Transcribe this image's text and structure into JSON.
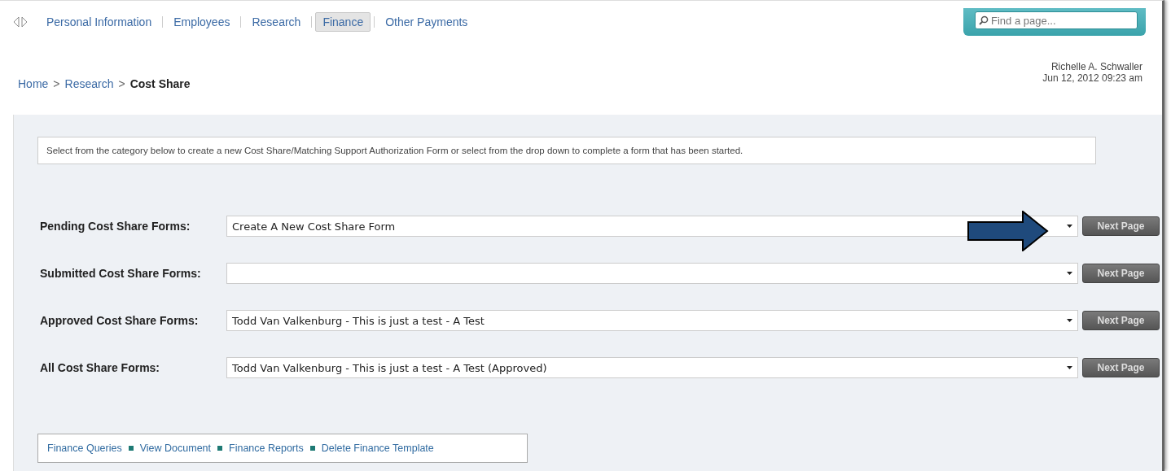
{
  "nav": {
    "tabs": [
      {
        "label": "Personal Information",
        "selected": false
      },
      {
        "label": "Employees",
        "selected": false
      },
      {
        "label": "Research",
        "selected": false
      },
      {
        "label": "Finance",
        "selected": true
      },
      {
        "label": "Other Payments",
        "selected": false
      }
    ]
  },
  "search": {
    "placeholder": "Find a page..."
  },
  "breadcrumb": {
    "links": [
      "Home",
      "Research"
    ],
    "separator": ">",
    "current": "Cost Share"
  },
  "user": {
    "name": "Richelle A. Schwaller",
    "datetime": "Jun 12, 2012 09:23 am"
  },
  "intro": "Select from the category below to create a new Cost Share/Matching Support Authorization Form or select from the drop down to complete a form that has been started.",
  "forms": [
    {
      "label": "Pending Cost Share Forms:",
      "value": "Create A New Cost Share Form",
      "button": "Next Page",
      "highlighted": true
    },
    {
      "label": "Submitted Cost Share Forms:",
      "button": "Next Page",
      "highlighted": false
    },
    {
      "label": "Approved Cost Share Forms:",
      "value": "Todd Van Valkenburg - This is just a test - A Test",
      "button": "Next Page",
      "highlighted": false
    },
    {
      "label": "All Cost Share Forms:",
      "value": "Todd Van Valkenburg - This is just a test - A Test (Approved)",
      "button": "Next Page",
      "highlighted": false
    }
  ],
  "footer_links": [
    "Finance Queries",
    "View Document",
    "Finance Reports",
    "Delete Finance Template"
  ]
}
